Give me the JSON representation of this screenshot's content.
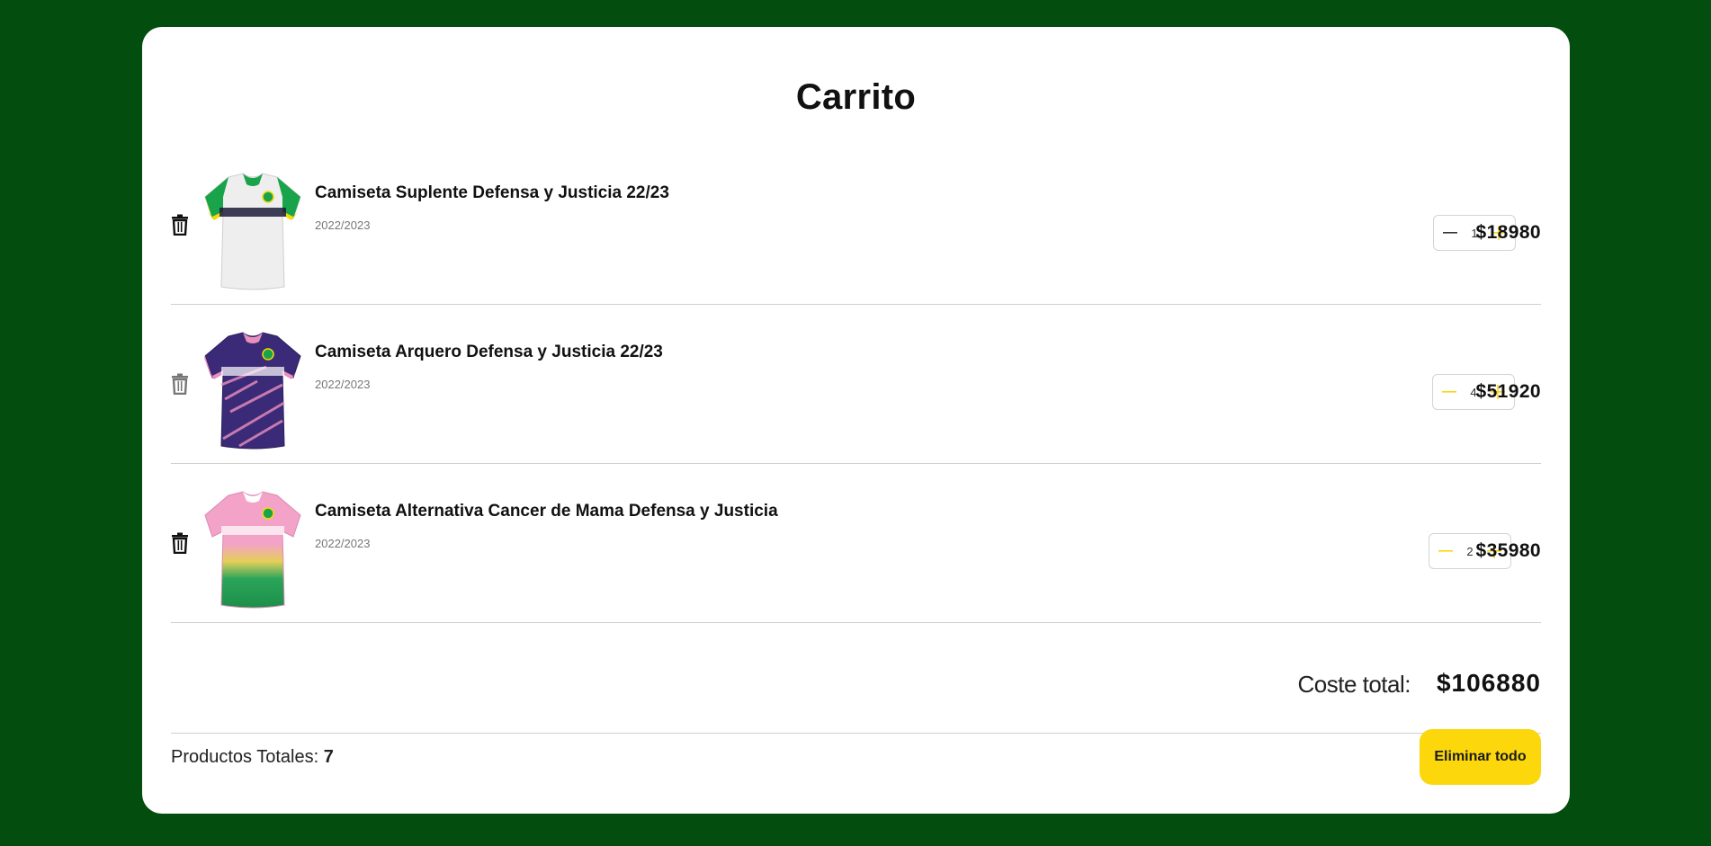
{
  "colors": {
    "background": "#034d0e",
    "accent": "#fbd70c",
    "card": "#ffffff"
  },
  "cart": {
    "title": "Carrito",
    "items": [
      {
        "name": "Camiseta Suplente Defensa y Justicia 22/23",
        "season": "2022/2023",
        "quantity": "1",
        "price": "$18980",
        "image": "white-green-jersey"
      },
      {
        "name": "Camiseta Arquero Defensa y Justicia 22/23",
        "season": "2022/2023",
        "quantity": "4",
        "price": "$51920",
        "image": "purple-pink-jersey"
      },
      {
        "name": "Camiseta Alternativa Cancer de Mama Defensa y Justicia",
        "season": "2022/2023",
        "quantity": "2",
        "price": "$35980",
        "image": "pink-green-jersey"
      }
    ],
    "total_label": "Coste total:",
    "total_value": "$106880",
    "products_label": "Productos Totales:",
    "products_count": "7",
    "clear_button": "Eliminar todo"
  }
}
